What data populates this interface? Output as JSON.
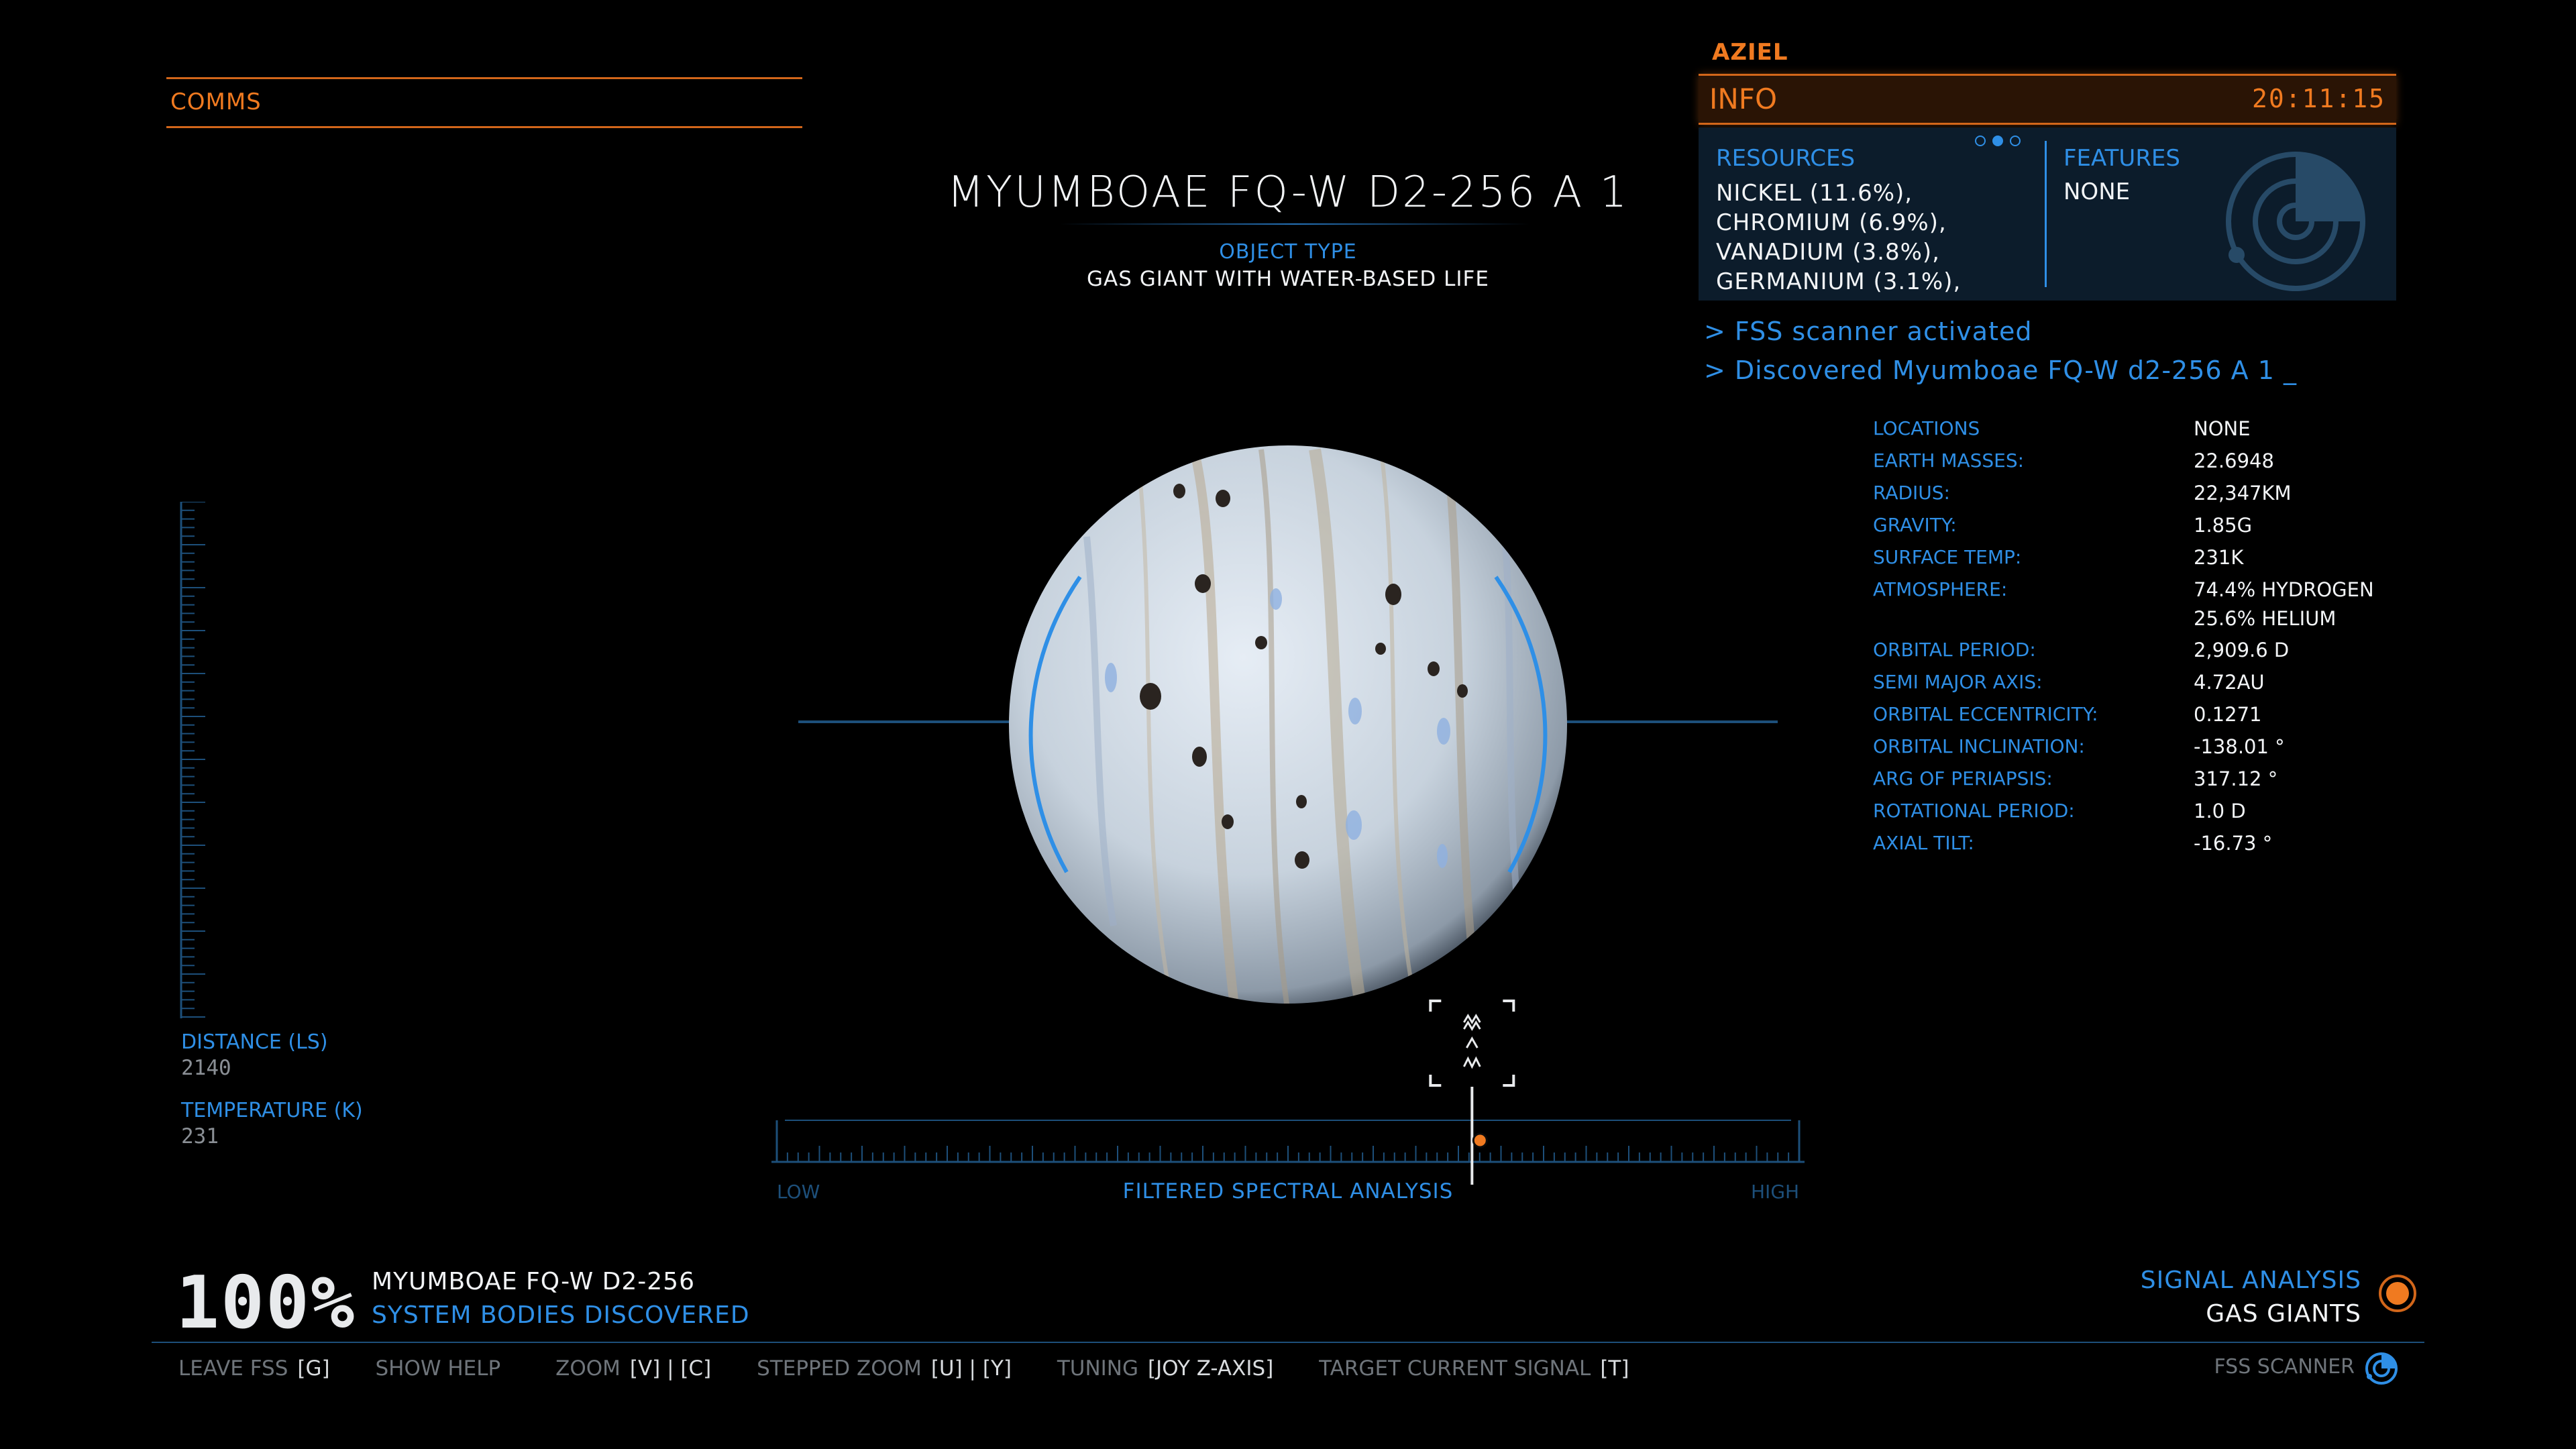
{
  "comms": {
    "label": "COMMS"
  },
  "body": {
    "title": "MYUMBOAE FQ-W D2-256 A 1",
    "object_type_label": "OBJECT TYPE",
    "object_type_value": "GAS GIANT WITH WATER-BASED LIFE"
  },
  "info_panel": {
    "commander": "AZIEL",
    "title": "INFO",
    "clock": "20:11:15",
    "resources_title": "RESOURCES",
    "resources": [
      "NICKEL (11.6%),",
      "CHROMIUM (6.9%),",
      "VANADIUM (3.8%),",
      "GERMANIUM (3.1%),"
    ],
    "features_title": "FEATURES",
    "features_value": "NONE"
  },
  "log": {
    "line1": "> FSS scanner activated",
    "line2": "> Discovered Myumboae FQ-W d2-256 A 1  _"
  },
  "stats": [
    {
      "label": "LOCATIONS",
      "value": "NONE"
    },
    {
      "label": "EARTH MASSES:",
      "value": "22.6948"
    },
    {
      "label": "RADIUS:",
      "value": "22,347KM"
    },
    {
      "label": "GRAVITY:",
      "value": "1.85G"
    },
    {
      "label": "SURFACE TEMP:",
      "value": "231K"
    },
    {
      "label": "ATMOSPHERE:",
      "value": "74.4% HYDROGEN",
      "value2": "25.6% HELIUM"
    },
    {
      "label": "ORBITAL PERIOD:",
      "value": "2,909.6 D"
    },
    {
      "label": "SEMI MAJOR AXIS:",
      "value": "4.72AU"
    },
    {
      "label": "ORBITAL ECCENTRICITY:",
      "value": "0.1271"
    },
    {
      "label": "ORBITAL INCLINATION:",
      "value": "-138.01 °"
    },
    {
      "label": "ARG OF PERIAPSIS:",
      "value": "317.12 °"
    },
    {
      "label": "ROTATIONAL PERIOD:",
      "value": "1.0 D"
    },
    {
      "label": "AXIAL TILT:",
      "value": "-16.73 °"
    }
  ],
  "readouts": {
    "distance_label": "DISTANCE (LS)",
    "distance_value": "2140",
    "temperature_label": "TEMPERATURE (K)",
    "temperature_value": "231"
  },
  "spectrum": {
    "low": "LOW",
    "high": "HIGH",
    "title": "FILTERED SPECTRAL ANALYSIS",
    "tuning_position": 0.68
  },
  "progress": {
    "percent": "100%",
    "system": "MYUMBOAE FQ-W D2-256",
    "label": "SYSTEM BODIES DISCOVERED"
  },
  "signal": {
    "label": "SIGNAL ANALYSIS",
    "value": "GAS GIANTS"
  },
  "controls": [
    {
      "label": "LEAVE FSS",
      "key": "[G]"
    },
    {
      "label": "SHOW HELP",
      "key": ""
    },
    {
      "label": "ZOOM",
      "key": "[V] | [C]"
    },
    {
      "label": "STEPPED ZOOM",
      "key": "[U] | [Y]"
    },
    {
      "label": "TUNING",
      "key": "[JOY Z-AXIS]"
    },
    {
      "label": "TARGET CURRENT SIGNAL",
      "key": "[T]"
    }
  ],
  "fss_scanner": {
    "label": "FSS SCANNER"
  },
  "colors": {
    "accent_orange": "#f07a20",
    "accent_blue": "#2f8fe6",
    "panel_bg": "#0c1c2b"
  }
}
